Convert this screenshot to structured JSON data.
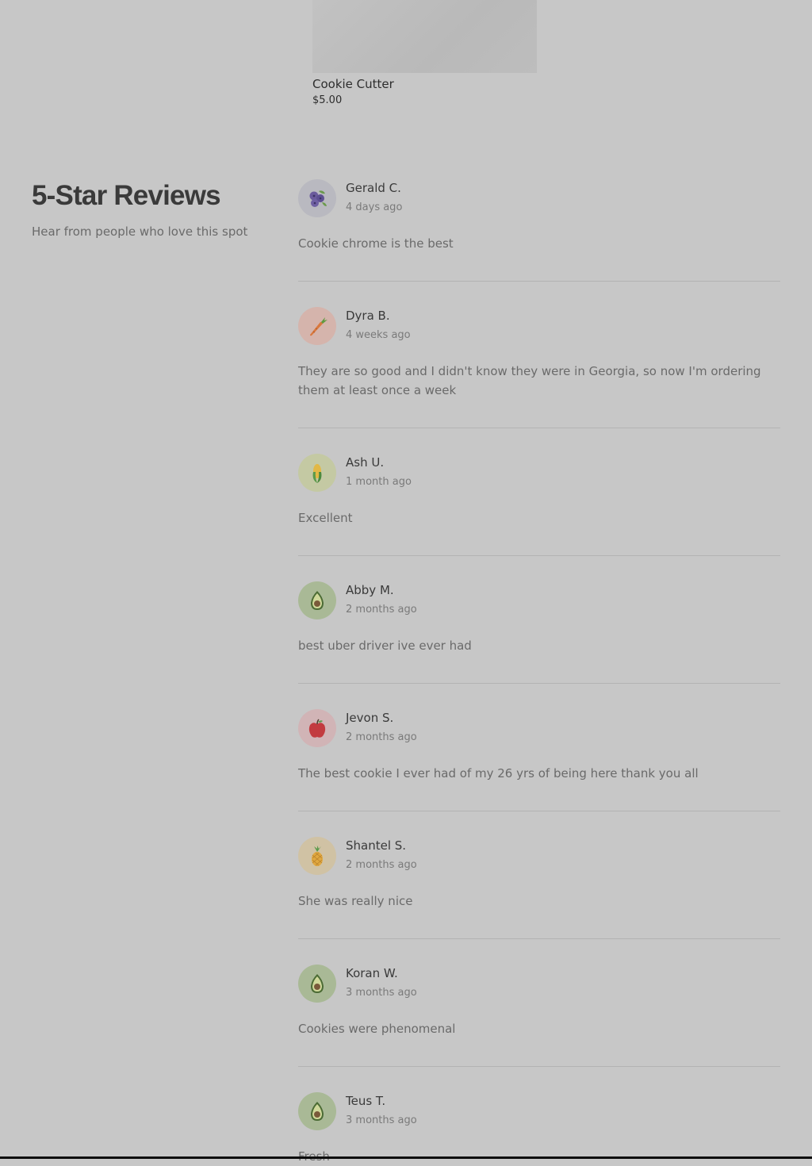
{
  "product": {
    "name": "Cookie Cutter",
    "price": "$5.00"
  },
  "reviews_section": {
    "title": "5-Star Reviews",
    "subtitle": "Hear from people who love this spot"
  },
  "reviews": [
    {
      "name": "Gerald C.",
      "date": "4 days ago",
      "text": "Cookie chrome is the best",
      "avatar_icon": "blueberry-icon",
      "avatar_bg": "#b9b9c0"
    },
    {
      "name": "Dyra B.",
      "date": "4 weeks ago",
      "text": "They are so good and I didn't know they were in Georgia, so now I'm ordering them at least once a week",
      "avatar_icon": "carrot-icon",
      "avatar_bg": "#d5b4ac"
    },
    {
      "name": "Ash U.",
      "date": "1 month ago",
      "text": "Excellent",
      "avatar_icon": "corn-icon",
      "avatar_bg": "#c4c9a3"
    },
    {
      "name": "Abby M.",
      "date": "2 months ago",
      "text": "best uber driver ive ever had",
      "avatar_icon": "avocado-icon",
      "avatar_bg": "#a9b996"
    },
    {
      "name": "Jevon S.",
      "date": "2 months ago",
      "text": "The best cookie I ever had of my 26 yrs of being here thank you all",
      "avatar_icon": "apple-icon",
      "avatar_bg": "#d1b4b6"
    },
    {
      "name": "Shantel S.",
      "date": "2 months ago",
      "text": "She was really nice",
      "avatar_icon": "pineapple-icon",
      "avatar_bg": "#d0c2a4"
    },
    {
      "name": "Koran W.",
      "date": "3 months ago",
      "text": "Cookies were phenomenal",
      "avatar_icon": "avocado-icon",
      "avatar_bg": "#a9b996"
    },
    {
      "name": "Teus T.",
      "date": "3 months ago",
      "text": "Fresh",
      "avatar_icon": "avocado-icon",
      "avatar_bg": "#a9b996"
    }
  ]
}
